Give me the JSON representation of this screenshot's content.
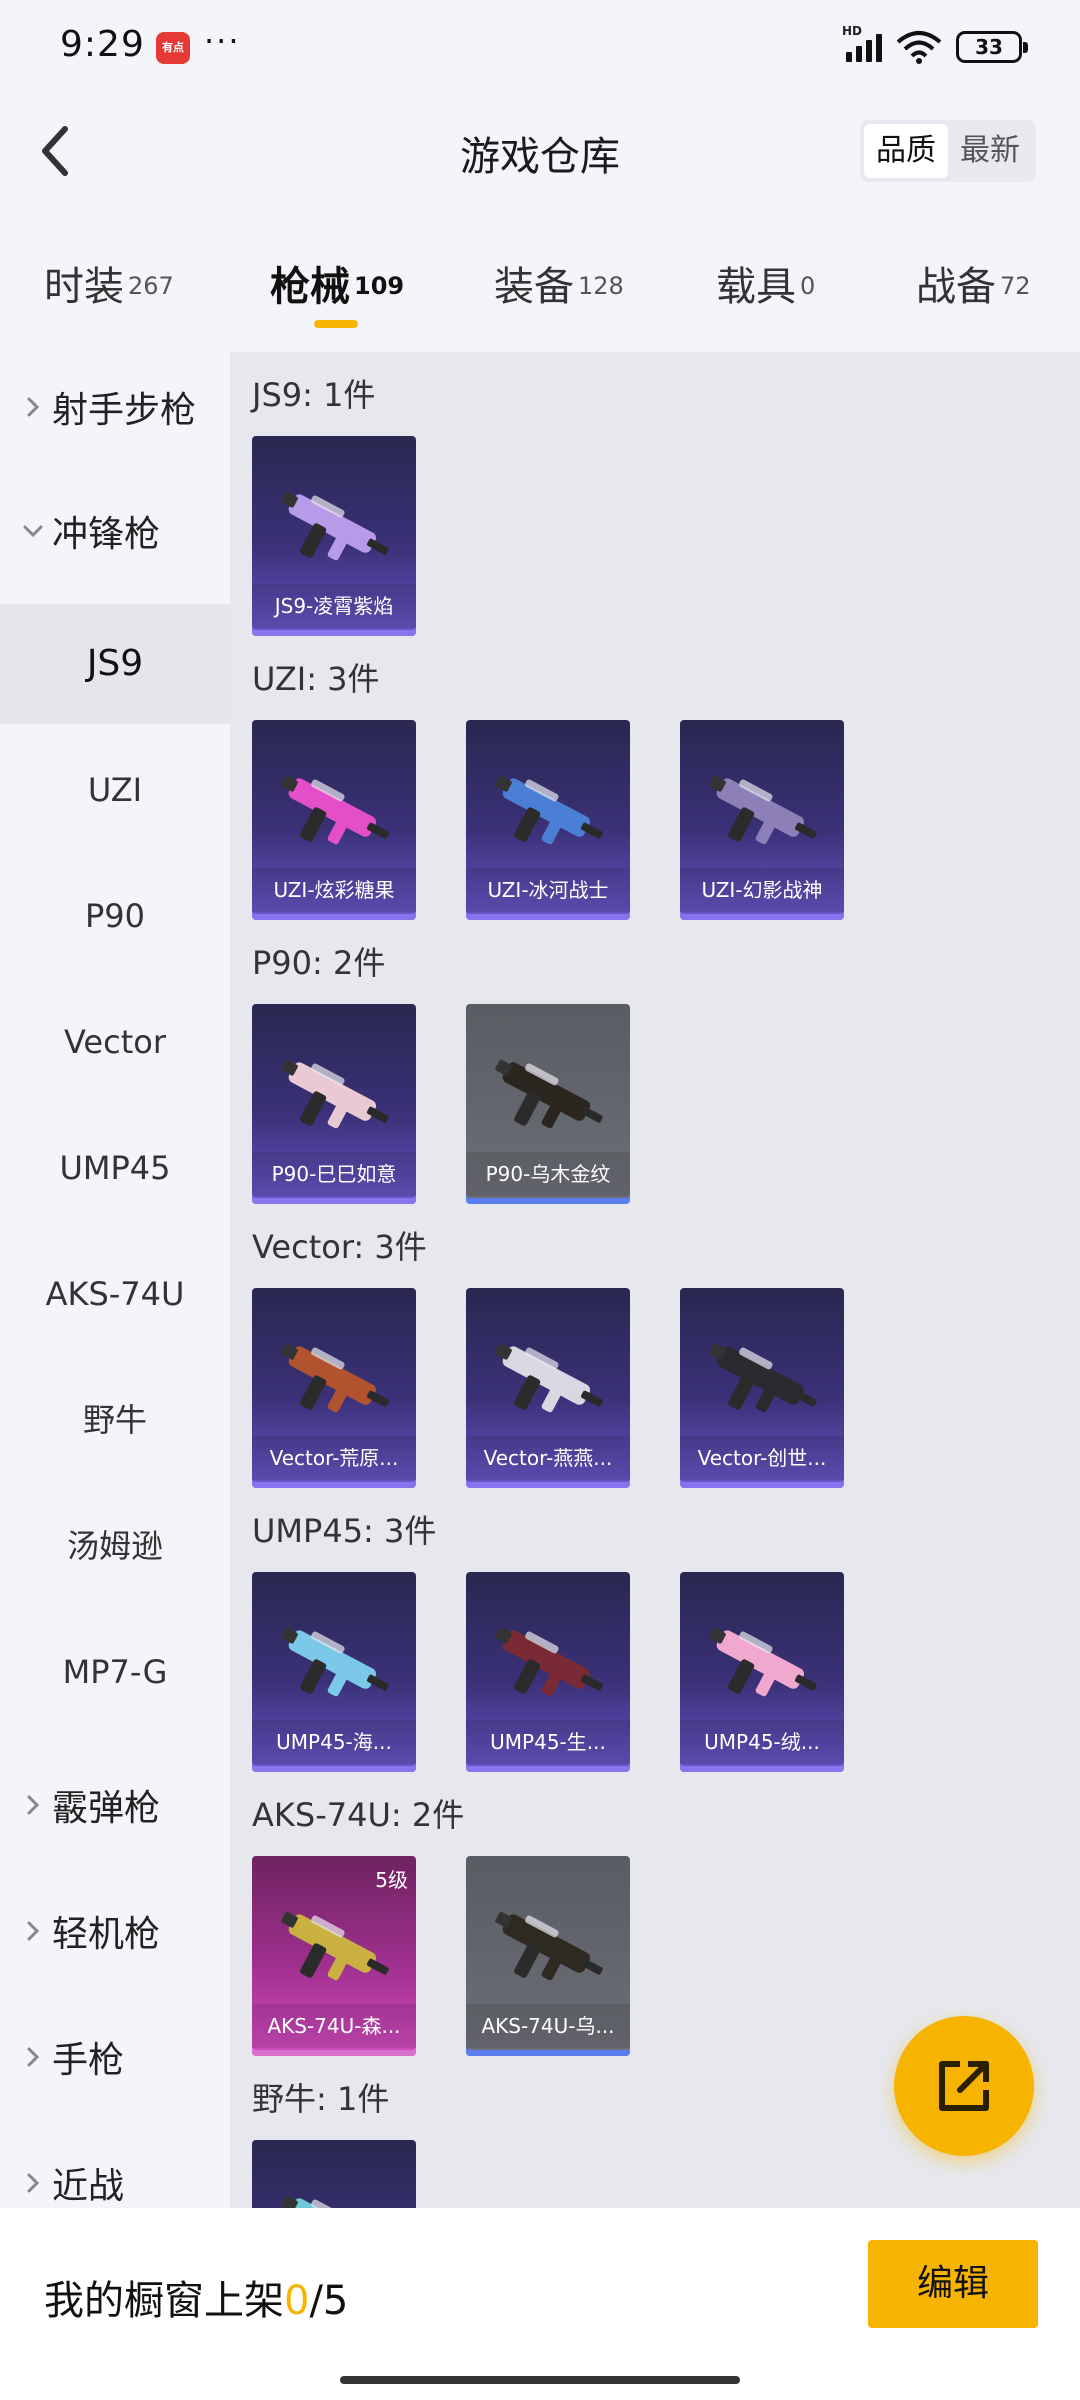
{
  "status_bar": {
    "time": "9:29",
    "app_badge": "有点",
    "dots": "···",
    "network": "HD",
    "wifi_sub": "6",
    "battery": "33"
  },
  "header": {
    "title": "游戏仓库",
    "sort_options": [
      "品质",
      "最新"
    ],
    "sort_active": "品质"
  },
  "category_tabs": [
    {
      "label": "时装",
      "count": "267"
    },
    {
      "label": "枪械",
      "count": "109",
      "active": true
    },
    {
      "label": "装备",
      "count": "128"
    },
    {
      "label": "载具",
      "count": "0"
    },
    {
      "label": "战备",
      "count": "72"
    }
  ],
  "sidebar": {
    "groups": [
      {
        "label": "射手步枪",
        "expanded": false
      },
      {
        "label": "冲锋枪",
        "expanded": true
      },
      {
        "label": "霰弹枪",
        "expanded": false
      },
      {
        "label": "轻机枪",
        "expanded": false
      },
      {
        "label": "手枪",
        "expanded": false
      },
      {
        "label": "近战",
        "expanded": false
      }
    ],
    "items": [
      "JS9",
      "UZI",
      "P90",
      "Vector",
      "UMP45",
      "AKS-74U",
      "野牛",
      "汤姆逊",
      "MP7-G"
    ],
    "active_item": "JS9"
  },
  "sections": [
    {
      "title": "JS9: 1件",
      "items": [
        {
          "name": "JS9-凌霄紫焰",
          "style": "purple",
          "gun_color": "#b79be8"
        }
      ]
    },
    {
      "title": "UZI: 3件",
      "items": [
        {
          "name": "UZI-炫彩糖果",
          "style": "purple",
          "gun_color": "#e24fc8"
        },
        {
          "name": "UZI-冰河战士",
          "style": "purple",
          "gun_color": "#4b7fd6"
        },
        {
          "name": "UZI-幻影战神",
          "style": "purple",
          "gun_color": "#8d80b8"
        }
      ]
    },
    {
      "title": "P90: 2件",
      "items": [
        {
          "name": "P90-巳巳如意",
          "style": "purple",
          "gun_color": "#e9c9d4"
        },
        {
          "name": "P90-乌木金纹",
          "style": "grey",
          "gun_color": "#2b2520"
        }
      ]
    },
    {
      "title": "Vector: 3件",
      "items": [
        {
          "name": "Vector-荒原...",
          "style": "purple",
          "gun_color": "#b0532e"
        },
        {
          "name": "Vector-燕燕...",
          "style": "purple",
          "gun_color": "#d8d8e2"
        },
        {
          "name": "Vector-创世...",
          "style": "purple",
          "gun_color": "#2a2a30"
        }
      ]
    },
    {
      "title": "UMP45: 3件",
      "items": [
        {
          "name": "UMP45-海...",
          "style": "purple",
          "gun_color": "#7cc8e8"
        },
        {
          "name": "UMP45-生...",
          "style": "purple",
          "gun_color": "#7a2a34"
        },
        {
          "name": "UMP45-绒...",
          "style": "purple",
          "gun_color": "#f0a8cf"
        }
      ]
    },
    {
      "title": "AKS-74U: 2件",
      "items": [
        {
          "name": "AKS-74U-森...",
          "style": "pink",
          "gun_color": "#c9b040",
          "level": "5级"
        },
        {
          "name": "AKS-74U-乌...",
          "style": "grey",
          "gun_color": "#2e2a22"
        }
      ]
    },
    {
      "title": "野牛: 1件",
      "items": [
        {
          "name": "",
          "style": "purple",
          "gun_color": "#6fc6d8"
        }
      ]
    }
  ],
  "bottom_bar": {
    "label": "我的橱窗上架",
    "current": "0",
    "total": "/5",
    "edit_label": "编辑"
  }
}
